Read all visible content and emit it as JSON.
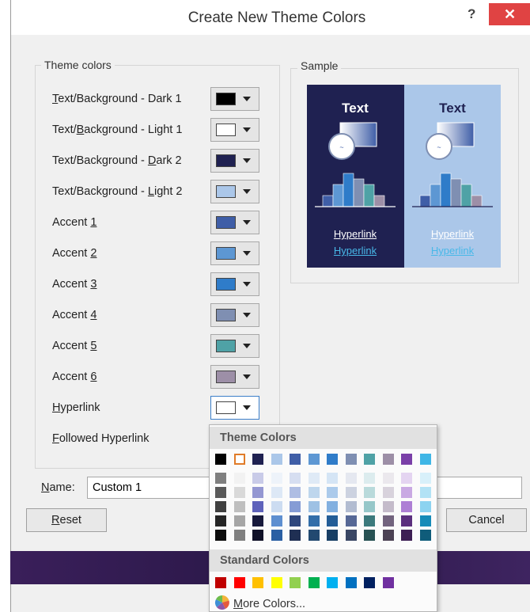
{
  "window": {
    "title": "Create New Theme Colors",
    "help_glyph": "?",
    "close_glyph": "✕"
  },
  "theme_group": {
    "title": "Theme colors",
    "rows": [
      {
        "pre": "",
        "key": "T",
        "post": "ext/Background - Dark 1",
        "color": "#000000"
      },
      {
        "pre": "Text/",
        "key": "B",
        "post": "ackground - Light 1",
        "color": "#ffffff"
      },
      {
        "pre": "Text/Background - ",
        "key": "D",
        "post": "ark 2",
        "color": "#1f2151"
      },
      {
        "pre": "Text/Background - ",
        "key": "L",
        "post": "ight 2",
        "color": "#abc7e9"
      },
      {
        "pre": "Accent ",
        "key": "1",
        "post": "",
        "color": "#3f5ea7"
      },
      {
        "pre": "Accent ",
        "key": "2",
        "post": "",
        "color": "#5d97d3"
      },
      {
        "pre": "Accent ",
        "key": "3",
        "post": "",
        "color": "#2f7cc9"
      },
      {
        "pre": "Accent ",
        "key": "4",
        "post": "",
        "color": "#7f8fb2"
      },
      {
        "pre": "Accent ",
        "key": "5",
        "post": "",
        "color": "#4fa2a6"
      },
      {
        "pre": "Accent ",
        "key": "6",
        "post": "",
        "color": "#9d8fa7"
      },
      {
        "pre": "",
        "key": "H",
        "post": "yperlink",
        "color": "#ffffff"
      },
      {
        "pre": "",
        "key": "F",
        "post": "ollowed Hyperlink",
        "color": null
      }
    ]
  },
  "sample": {
    "title": "Sample",
    "text_label": "Text",
    "hyperlink": "Hyperlink",
    "followed_hyperlink": "Hyperlink",
    "dark_bg": "#1f2151",
    "light_bg": "#abc7e9",
    "bar_colors": [
      "#3f5ea7",
      "#5d97d3",
      "#2f7cc9",
      "#7f8fb2",
      "#4fa2a6",
      "#9d8fa7"
    ],
    "bar_values": [
      2,
      4,
      6,
      5,
      4,
      2
    ]
  },
  "name_field": {
    "label_key": "N",
    "label_rest": "ame:",
    "value": "Custom 1"
  },
  "buttons": {
    "reset_key": "R",
    "reset_rest": "eset",
    "cancel": "Cancel"
  },
  "dropdown": {
    "theme_header": "Theme Colors",
    "standard_header": "Standard Colors",
    "more_colors_key": "M",
    "more_colors_rest": "ore Colors...",
    "theme_top": [
      "#000000",
      "#ffffff",
      "#1f2151",
      "#abc7e9",
      "#3f5ea7",
      "#5d97d3",
      "#2f7cc9",
      "#7f8fb2",
      "#4fa2a6",
      "#9d8fa7",
      "#7a3fa8",
      "#3fb6e6"
    ],
    "theme_shades": [
      [
        "#7f7f7f",
        "#595959",
        "#404040",
        "#262626",
        "#0d0d0d"
      ],
      [
        "#f2f2f2",
        "#d9d9d9",
        "#bfbfbf",
        "#a6a6a6",
        "#808080"
      ],
      [
        "#c9cbe8",
        "#9497d2",
        "#5e62bb",
        "#17193c",
        "#101128"
      ],
      [
        "#eef3fa",
        "#dde8f6",
        "#ccdcf1",
        "#5e8fd0",
        "#2a5fa3"
      ],
      [
        "#d6def1",
        "#aebde3",
        "#859cd5",
        "#2f477d",
        "#1f2f53"
      ],
      [
        "#dfeaf6",
        "#bed6ed",
        "#9ec1e4",
        "#336ea9",
        "#224970"
      ],
      [
        "#d5e5f5",
        "#abcaeb",
        "#82b0e0",
        "#235d97",
        "#173e64"
      ],
      [
        "#e5e8f0",
        "#ccd2e0",
        "#b2bcd1",
        "#566896",
        "#394664"
      ],
      [
        "#dcecee",
        "#b9dadb",
        "#96c7c9",
        "#3b797c",
        "#275153"
      ],
      [
        "#ebe8ed",
        "#d8d2dc",
        "#c4bbca",
        "#72637e",
        "#4c4254"
      ],
      [
        "#e4d4f1",
        "#c9a9e3",
        "#ae7fd5",
        "#5b2f7e",
        "#3d1f54"
      ],
      [
        "#d8f0fa",
        "#b2e2f5",
        "#8cd3f0",
        "#168bb8",
        "#0f5c7a"
      ]
    ],
    "standard": [
      "#c00000",
      "#ff0000",
      "#ffc000",
      "#ffff00",
      "#92d050",
      "#00b050",
      "#00b0f0",
      "#0070c0",
      "#002060",
      "#7030a0"
    ]
  }
}
